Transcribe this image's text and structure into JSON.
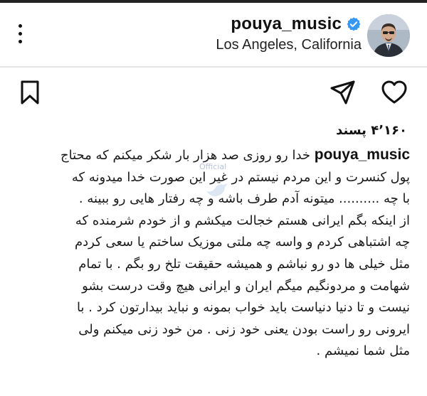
{
  "header": {
    "username": "pouya_music",
    "location": "Los Angeles, California"
  },
  "icons": {
    "menu": "more-vertical-icon",
    "verified": "verified-badge-icon",
    "save": "bookmark-icon",
    "share": "send-icon",
    "like": "heart-icon"
  },
  "colors": {
    "verified_blue": "#3897f0",
    "text": "#111111",
    "divider": "#e4e4e4"
  },
  "post": {
    "likes_label": "۴٬۱۶۰ پسند",
    "caption_username": "pouya_music",
    "caption_lines": [
      "خدا رو روزی صد هزار بار شکر میکنم که محتاج",
      "پول کنسرت و این مردم نیستم در غیر این صورت خدا میدونه که",
      "با چه .......... میتونه آدم طرف باشه و چه رفتار هایی رو ببینه .",
      "از اینکه بگم ایرانی هستم خجالت میکشم و از خودم شرمنده که",
      "چه اشتباهی کردم و واسه چه ملتی موزیک ساختم یا سعی کردم",
      "مثل خیلی ها دو رو نباشم و همیشه حقیقت تلخ رو بگم . با تمام",
      "شهامت و مردونگیم میگم ایران و ایرانی هیچ وقت درست بشو",
      "نیست و تا دنیا دنیاست باید خواب بمونه و نباید بیدارتون کرد . با",
      "ایرونی رو راست بودن یعنی خود زنی . من خود زنی میکنم ولی",
      "مثل شما نمیشم ."
    ]
  },
  "watermark": {
    "text": "Official"
  }
}
